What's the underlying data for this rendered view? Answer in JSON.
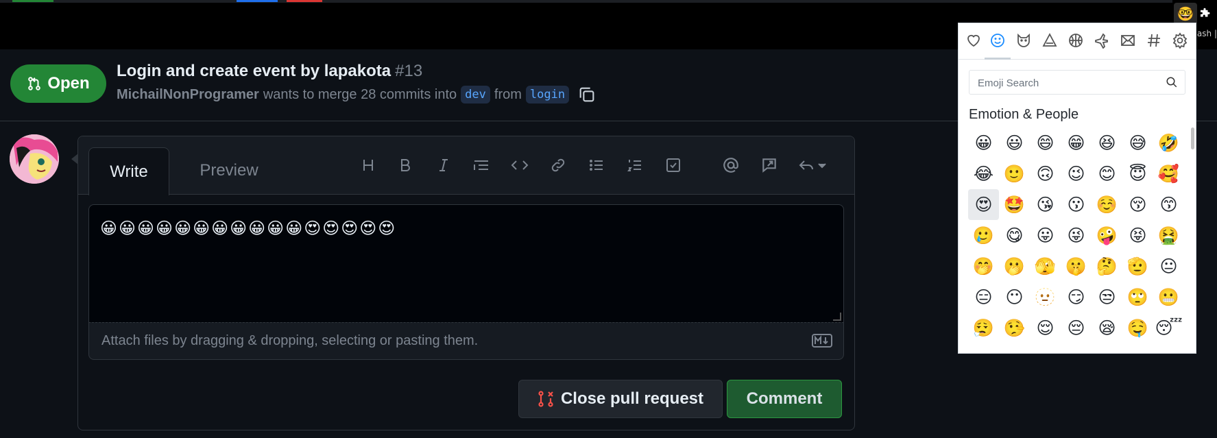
{
  "browser": {
    "extensions": [
      {
        "icon": "emoji-extension-icon",
        "glyph": "🤓"
      },
      {
        "icon": "puzzle-icon",
        "glyph": "🧩"
      }
    ],
    "partial_text": "lash |"
  },
  "pull_request": {
    "state": "Open",
    "title": "Login and create event by lapakota",
    "number": "#13",
    "author": "MichailNonProgramer",
    "merge_text": "wants to merge 28 commits into",
    "base_branch": "dev",
    "from_text": "from",
    "head_branch": "login",
    "state_color": "#238636"
  },
  "comment": {
    "tabs": {
      "write": "Write",
      "preview": "Preview"
    },
    "toolbar_icons": [
      "heading-icon",
      "bold-icon",
      "italic-icon",
      "quote-icon",
      "code-icon",
      "link-icon",
      "unordered-list-icon",
      "ordered-list-icon",
      "task-list-icon",
      "mention-icon",
      "reference-icon",
      "reply-icon"
    ],
    "text": "😀😀😀😀😀😀😀😀😀😀😀😍😍😍😍😍",
    "attach_hint": "Attach files by dragging & dropping, selecting or pasting them.",
    "close_label": "Close pull request",
    "comment_label": "Comment"
  },
  "emoji_picker": {
    "categories": [
      "heart-icon",
      "smiley-icon",
      "animal-icon",
      "food-icon",
      "ball-icon",
      "plane-icon",
      "envelope-icon",
      "hash-icon",
      "settings-icon"
    ],
    "active_category": "smiley-icon",
    "search_placeholder": "Emoji Search",
    "section_title": "Emotion & People",
    "emojis": [
      "😀",
      "😃",
      "😄",
      "😁",
      "😆",
      "😅",
      "🤣",
      "😂",
      "🙂",
      "🙃",
      "😉",
      "😊",
      "😇",
      "🥰",
      "😍",
      "🤩",
      "😘",
      "😗",
      "☺️",
      "😚",
      "😙",
      "🥲",
      "😋",
      "😛",
      "😜",
      "🤪",
      "😝",
      "🤮",
      "🤭",
      "🫢",
      "🫣",
      "🤫",
      "🤔",
      "🫡",
      "😐",
      "😑",
      "😶",
      "🫥",
      "😏",
      "😒",
      "🙄",
      "😬",
      "😮‍💨",
      "🤥",
      "😌",
      "😔",
      "😪",
      "🤤",
      "😴"
    ],
    "hovered_index": 14
  }
}
